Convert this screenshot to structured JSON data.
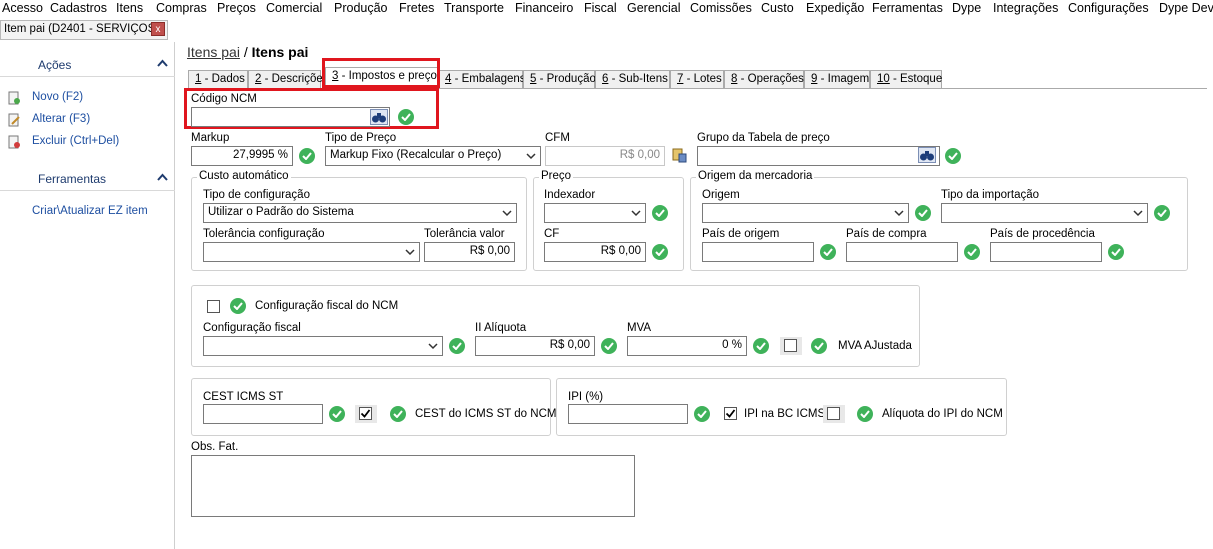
{
  "menu": [
    "Acesso",
    "Cadastros",
    "Itens",
    "Compras",
    "Preços",
    "Comercial",
    "Produção",
    "Fretes",
    "Transporte",
    "Financeiro",
    "Fiscal",
    "Gerencial",
    "Comissões",
    "Custo",
    "Expedição",
    "Ferramentas",
    "Dype",
    "Integrações",
    "Configurações",
    "Dype Dev"
  ],
  "doc_tab": {
    "title": "Item pai (D2401 - SERVIÇOS)",
    "close": "x"
  },
  "sidebar": {
    "acoes_title": "Ações",
    "novo": "Novo (F2)",
    "alterar": "Alterar (F3)",
    "excluir": "Excluir (Ctrl+Del)",
    "ferramentas_title": "Ferramentas",
    "criar": "Criar\\Atualizar EZ item"
  },
  "breadcrumb": {
    "parent": "Itens pai",
    "sep": "/",
    "current": "Itens pai"
  },
  "tabs": [
    {
      "num": "1",
      "label": " - Dados"
    },
    {
      "num": "2",
      "label": " - Descrições"
    },
    {
      "num": "3",
      "label": " - Impostos e preço"
    },
    {
      "num": "4",
      "label": " - Embalagens"
    },
    {
      "num": "5",
      "label": " - Produção"
    },
    {
      "num": "6",
      "label": " - Sub-Itens"
    },
    {
      "num": "7",
      "label": " - Lotes"
    },
    {
      "num": "8",
      "label": " - Operações"
    },
    {
      "num": "9",
      "label": " - Imagem"
    },
    {
      "num": "10",
      "label": " - Estoque"
    }
  ],
  "form": {
    "codigo_ncm_label": "Código NCM",
    "codigo_ncm_value": "",
    "markup_label": "Markup",
    "markup_value": "27,9995 %",
    "tipo_preco_label": "Tipo de Preço",
    "tipo_preco_value": "Markup Fixo (Recalcular o Preço)",
    "cfm_label": "CFM",
    "cfm_value": "R$ 0,00",
    "grupo_tabela_label": "Grupo da Tabela de preço",
    "grupo_tabela_value": "",
    "custo_auto_title": "Custo automático",
    "tipo_config_label": "Tipo de configuração",
    "tipo_config_value": "Utilizar o Padrão do Sistema",
    "tol_config_label": "Tolerância configuração",
    "tol_config_value": "",
    "tol_valor_label": "Tolerância valor",
    "tol_valor_value": "R$ 0,00",
    "preco_title": "Preço",
    "indexador_label": "Indexador",
    "indexador_value": "",
    "cf_label": "CF",
    "cf_value": "R$ 0,00",
    "origem_merc_title": "Origem da mercadoria",
    "origem_label": "Origem",
    "origem_value": "",
    "tipo_importacao_label": "Tipo da importação",
    "tipo_importacao_value": "",
    "pais_origem_label": "País de origem",
    "pais_compra_label": "País de compra",
    "pais_procedencia_label": "País de procedência",
    "config_fiscal_ncm_label": "Configuração fiscal do NCM",
    "config_fiscal_label": "Configuração fiscal",
    "ii_aliquota_label": "II Alíquota",
    "ii_aliquota_value": "R$ 0,00",
    "mva_label": "MVA",
    "mva_value": "0 %",
    "mva_ajustada_label": "MVA AJustada",
    "cest_label": "CEST ICMS ST",
    "cest_ncm_label": "CEST do ICMS ST do NCM",
    "ipi_label": "IPI (%)",
    "ipi_bc_label": "IPI na BC ICMS",
    "aliquota_ipi_ncm_label": "Alíquota do IPI do NCM",
    "obs_label": "Obs. Fat."
  },
  "colors": {
    "accent_red": "#e0161e",
    "ok_green": "#3fb25a",
    "link_blue": "#1e4fa1"
  }
}
